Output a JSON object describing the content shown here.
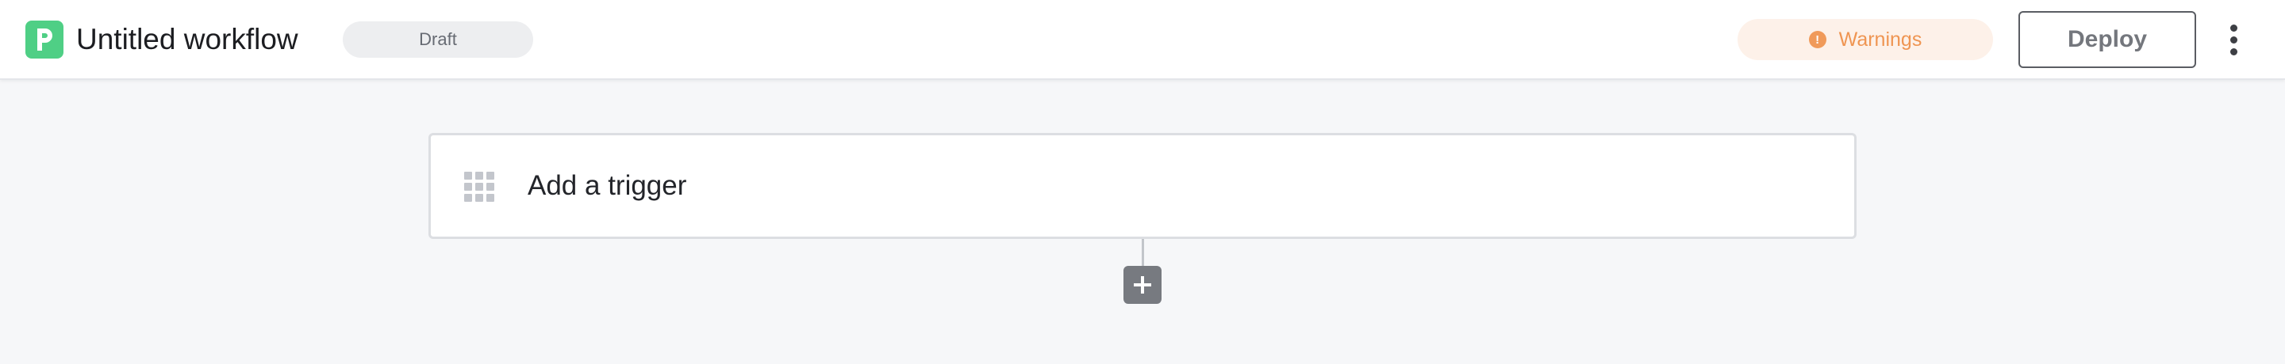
{
  "header": {
    "title": "Untitled workflow",
    "status": "Draft",
    "warnings_label": "Warnings",
    "warnings_badge": "!",
    "deploy_label": "Deploy"
  },
  "canvas": {
    "trigger_label": "Add a trigger"
  },
  "icons": {
    "logo": "pipedream-p-logo",
    "more": "vertical-dots-icon",
    "trigger": "grid-icon",
    "add": "plus-icon"
  },
  "colors": {
    "brand": "#4fcf85",
    "warning": "#ef9552",
    "warning_bg": "#fdf1e9"
  }
}
